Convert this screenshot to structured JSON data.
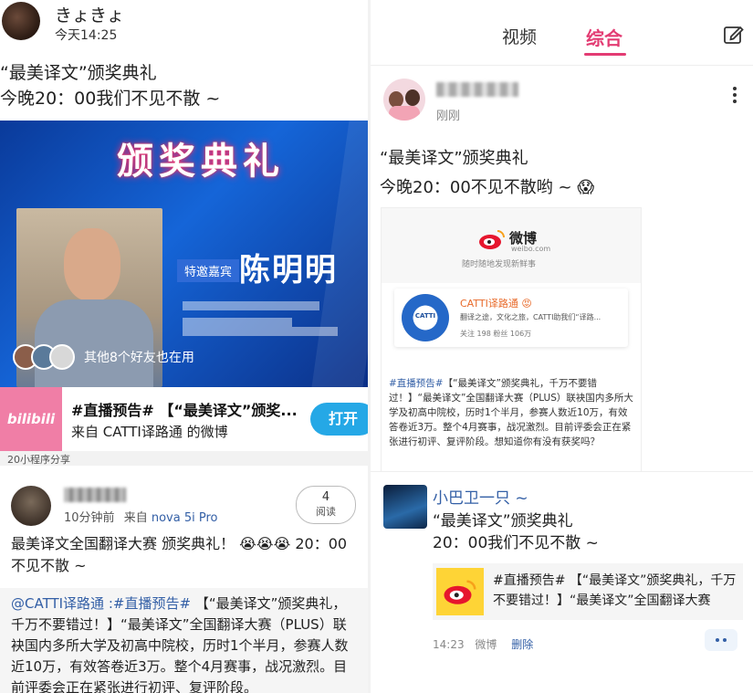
{
  "left": {
    "username": "きょきょ",
    "time": "今天14:25",
    "post_lines": [
      "“最美译文”颁奖典礼",
      "今晚20：00我们不见不散 ~"
    ],
    "video": {
      "title": "颁奖典礼",
      "guest_tag": "特邀嘉宾",
      "guest_name": "陈明明",
      "friends_text": "其他8个好友也在用"
    },
    "card": {
      "logo": "bilibili",
      "title": "#直播预告# 【“最美译文”颁奖...",
      "subtitle": "来自 CATTI译路通 的微博",
      "open_button": "打开"
    },
    "share_strip": "20小程序分享",
    "comment": {
      "time": "10分钟前",
      "source_prefix": "来自",
      "source": "nova 5i Pro",
      "read_count": "4",
      "read_label": "阅读",
      "text": "最美译文全国翻译大赛 颁奖典礼！ 😭😭😭 20：00不见不散 ~",
      "quote_mention": "@CATTI译路通",
      "quote_topic": ":#直播预告#",
      "quote_text": "【“最美译文”颁奖典礼，千万不要错过！】“最美译文”全国翻译大赛（PLUS）联袂国内多所大学及初高中院校，历时1个半月，参赛人数近10万，有效答卷近3万。整个4月赛事，战况激烈。目前评委会正在紧张进行初评、复评阶段。"
    }
  },
  "right": {
    "tabs": [
      "视频",
      "综合"
    ],
    "active_tab": "综合",
    "post": {
      "time": "刚刚",
      "lines": [
        "“最美译文”颁奖典礼",
        "今晚20：00不见不散哟 ~ 😱"
      ],
      "image": {
        "weibo_word": "微博",
        "weibo_url": "weibo.com",
        "slogan": "随时随地发现新鲜事",
        "account_name": "CATTI译路通 😡",
        "account_desc": "翻译之途，文化之旅，CATTI助我们“译路...",
        "stats": "关注 198    粉丝 106万",
        "body_topic": "#直播预告#",
        "body_text": "【“最美译文”颁奖典礼，千万不要错过！】“最美译文”全国翻译大赛（PLUS）联袂国内多所大学及初高中院校，历时1个半月，参赛人数近10万，有效答卷近3万。整个4月赛事，战况激烈。目前评委会正在紧张进行初评、复评阶段。想知道你有没有获奖吗？"
      }
    },
    "repost": {
      "name": "小巴卫一只 ~",
      "lines": [
        "“最美译文”颁奖典礼",
        "20：00我们不见不散 ~"
      ],
      "card_text": "#直播预告# 【“最美译文”颁奖典礼，千万不要错过！】“最美译文”全国翻译大赛",
      "time": "14:23",
      "source": "微博",
      "delete": "删除"
    }
  },
  "colors": {
    "accent_pink": "#e33c73",
    "link_blue": "#335fa6",
    "open_button": "#25a8e6",
    "bilibili_pink": "#f07ea6",
    "weibo_yellow": "#fed436"
  }
}
